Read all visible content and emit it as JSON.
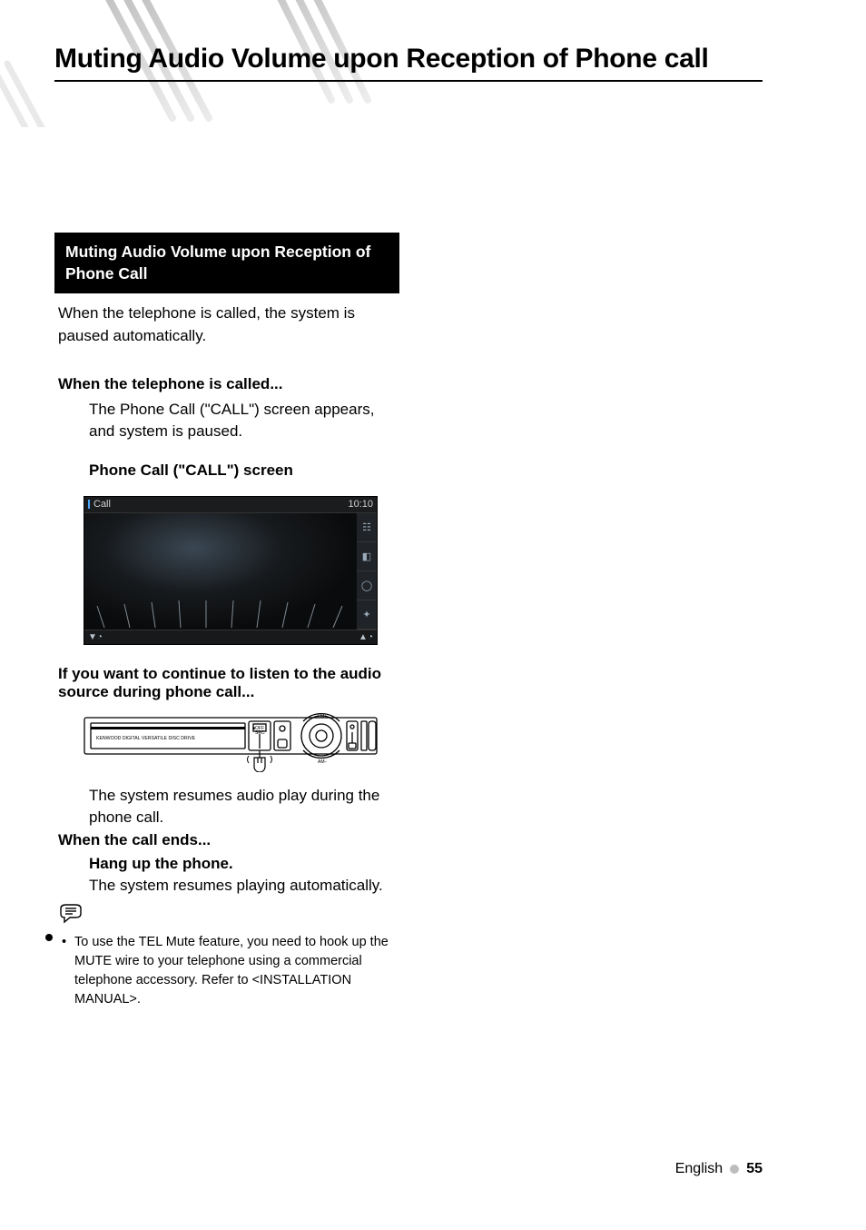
{
  "page_title": "Muting Audio Volume upon Reception of Phone call",
  "section": {
    "heading": "Muting Audio Volume upon Reception of Phone Call",
    "intro": "When the telephone is called, the system is paused automatically.",
    "step1": {
      "head": "When the telephone is called...",
      "body": "The Phone Call (\"CALL\") screen appears, and system is paused.",
      "sub": "Phone Call (\"CALL\") screen"
    },
    "call_screen": {
      "title": "Call",
      "clock": "10:10",
      "down": "▼",
      "up": "▲"
    },
    "step2": {
      "head": "If you want to continue to listen to the audio source during phone call...",
      "device_label": "KENWOOD DIGITAL VERSATILE DISC DRIVE",
      "body": "The system resumes audio play during the phone call."
    },
    "step3": {
      "head": "When the call ends...",
      "sub": "Hang up the phone.",
      "body": "The system resumes playing automatically."
    },
    "note": "To use the TEL Mute feature, you need to hook up the MUTE wire to your telephone using a commercial telephone accessory.  Refer to <INSTALLATION MANUAL>."
  },
  "footer": {
    "lang": "English",
    "page": "55"
  }
}
